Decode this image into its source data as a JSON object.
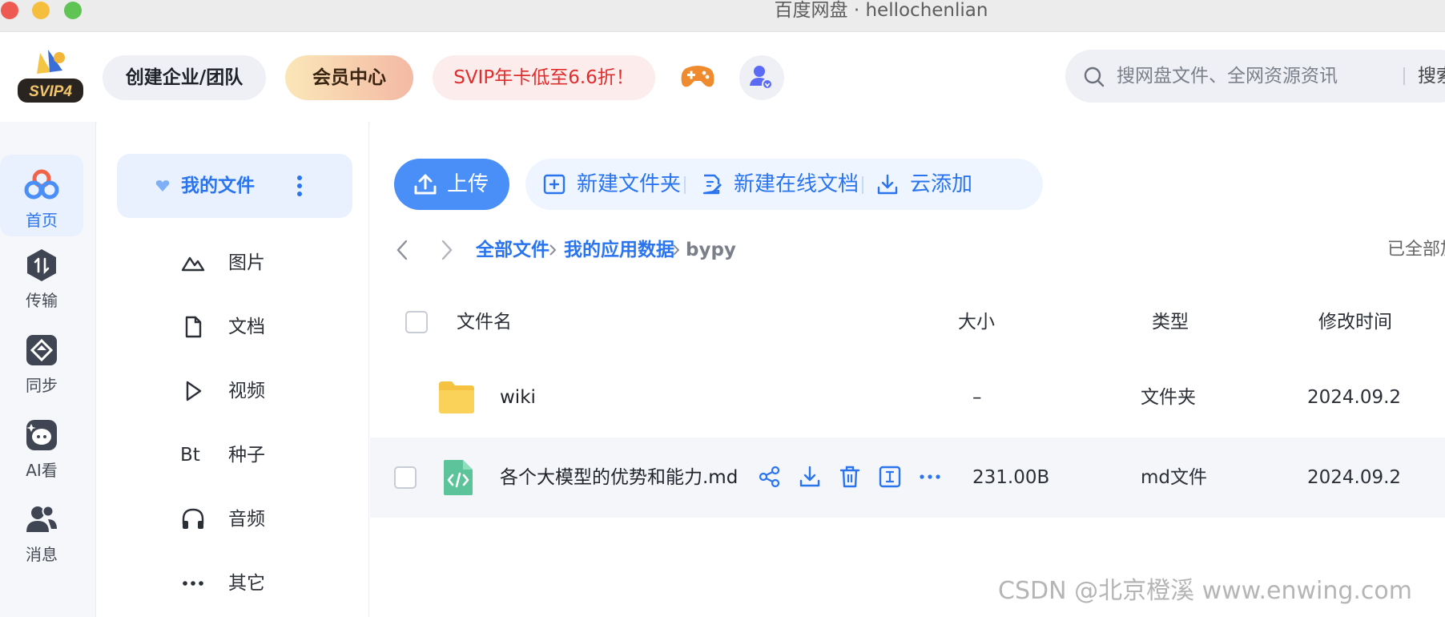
{
  "window": {
    "title": "百度网盘 · hellochenlian"
  },
  "header": {
    "logo_text": "SVIP4",
    "team_button": "创建企业/团队",
    "vip_button": "会员中心",
    "promo_button": "SVIP年卡低至6.6折！",
    "search_placeholder": "搜网盘文件、全网资源资讯",
    "search_button": "搜索"
  },
  "leftnav": {
    "items": [
      {
        "label": "首页",
        "icon": "home-icon",
        "active": true
      },
      {
        "label": "传输",
        "icon": "transfer-icon"
      },
      {
        "label": "同步",
        "icon": "sync-icon"
      },
      {
        "label": "AI看",
        "icon": "ai-icon"
      },
      {
        "label": "消息",
        "icon": "message-icon"
      }
    ]
  },
  "sidebar": {
    "my_files": "我的文件",
    "categories": [
      {
        "label": "图片",
        "icon": "image-icon"
      },
      {
        "label": "文档",
        "icon": "document-icon"
      },
      {
        "label": "视频",
        "icon": "video-icon"
      },
      {
        "label": "种子",
        "icon": "torrent-icon",
        "glyph": "Bt"
      },
      {
        "label": "音频",
        "icon": "audio-icon"
      },
      {
        "label": "其它",
        "icon": "other-icon"
      }
    ]
  },
  "toolbar": {
    "upload": "上传",
    "new_folder": "新建文件夹",
    "new_doc": "新建在线文档",
    "cloud_add": "云添加"
  },
  "breadcrumb": {
    "items": [
      "全部文件",
      "我的应用数据",
      "bypy"
    ],
    "status": "已全部加载"
  },
  "table": {
    "columns": {
      "name": "文件名",
      "size": "大小",
      "type": "类型",
      "modified": "修改时间"
    },
    "rows": [
      {
        "name": "wiki",
        "size": "–",
        "type": "文件夹",
        "modified": "2024.09.2",
        "icon": "folder-icon"
      },
      {
        "name": "各个大模型的优势和能力.md",
        "size": "231.00B",
        "type": "md文件",
        "modified": "2024.09.2",
        "icon": "code-file-icon"
      }
    ]
  },
  "watermark": "CSDN @北京橙溪 www.enwing.com",
  "colors": {
    "accent": "#2a74f0",
    "upload_bg": "#4a8ff7",
    "promo_text": "#e02d2d"
  }
}
